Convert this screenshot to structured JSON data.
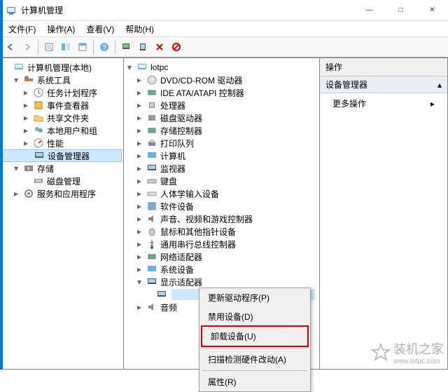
{
  "window": {
    "title": "计算机管理",
    "min": "—",
    "max": "□",
    "close": "✕"
  },
  "menu": {
    "file": "文件(F)",
    "action": "操作(A)",
    "view": "查看(V)",
    "help": "帮助(H)"
  },
  "left_tree": {
    "root": "计算机管理(本地)",
    "tools": "系统工具",
    "task": "任务计划程序",
    "event": "事件查看器",
    "shared": "共享文件夹",
    "users": "本地用户和组",
    "perf": "性能",
    "devmgr": "设备管理器",
    "storage": "存储",
    "diskmgr": "磁盘管理",
    "services": "服务和应用程序"
  },
  "mid_tree": {
    "root": "lotpc",
    "dvd": "DVD/CD-ROM 驱动器",
    "ide": "IDE ATA/ATAPI 控制器",
    "cpu": "处理器",
    "disk": "磁盘驱动器",
    "storage": "存储控制器",
    "printq": "打印队列",
    "computer": "计算机",
    "monitor": "监视器",
    "keyboard": "键盘",
    "hid": "人体学输入设备",
    "software": "软件设备",
    "sound": "声音、视频和游戏控制器",
    "mouse": "鼠标和其他指针设备",
    "usb": "通用串行总线控制器",
    "network": "网络适配器",
    "system": "系统设备",
    "display": "显示适配器",
    "audio": "音频"
  },
  "actions": {
    "header": "操作",
    "group": "设备管理器",
    "more": "更多操作"
  },
  "context": {
    "update": "更新驱动程序(P)",
    "disable": "禁用设备(D)",
    "uninstall": "卸载设备(U)",
    "scan": "扫描检测硬件改动(A)",
    "props": "属性(R)"
  },
  "watermark": {
    "text": "装机之家",
    "url": "www.lotpc.com"
  }
}
